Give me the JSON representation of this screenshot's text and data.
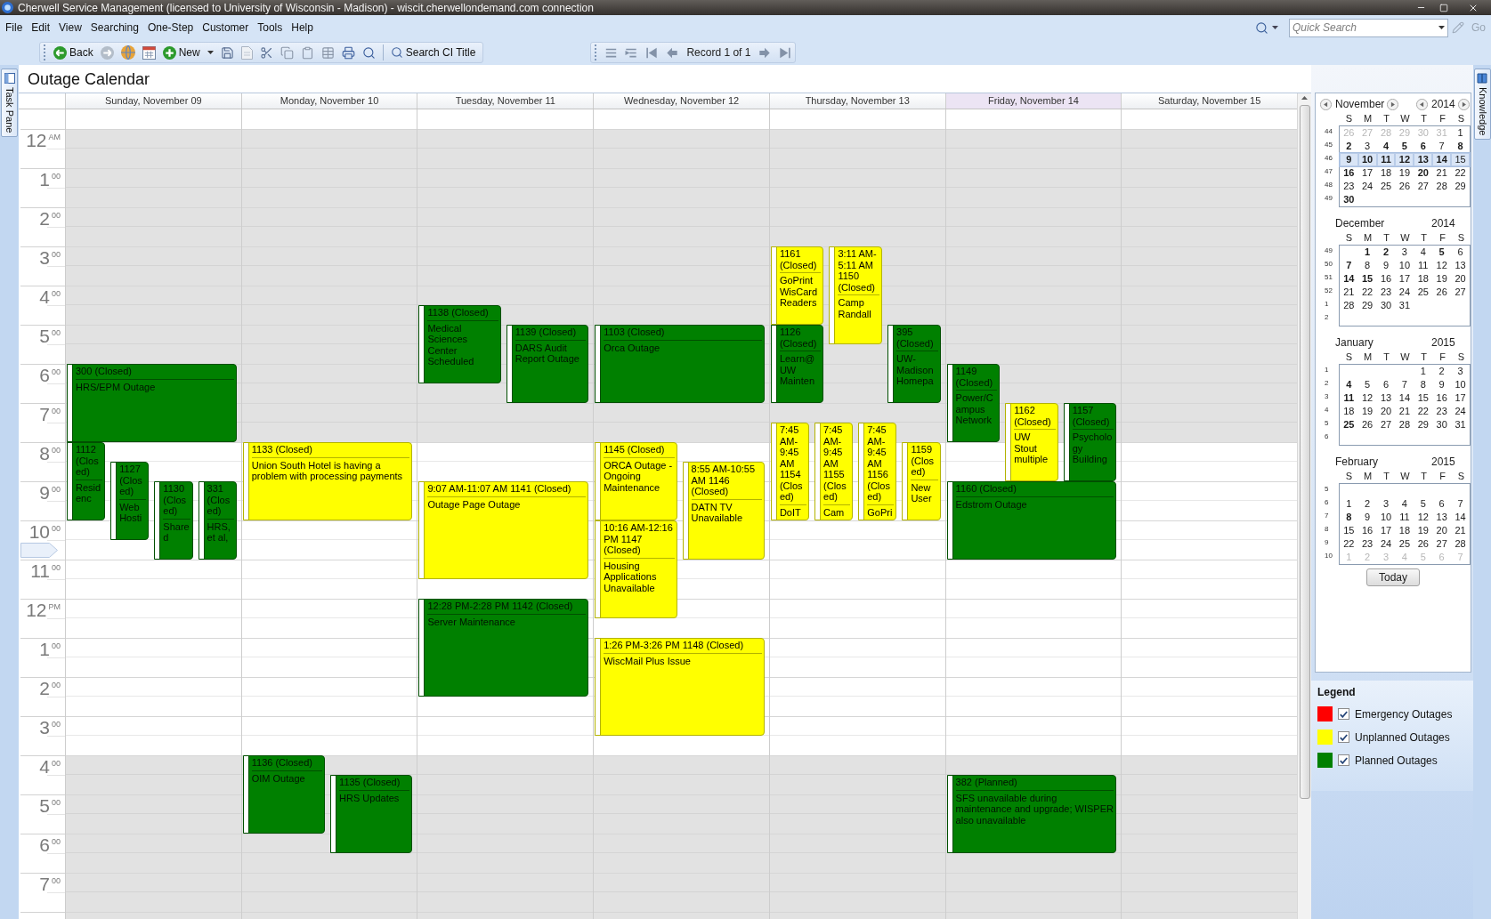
{
  "window": {
    "title": "Cherwell Service Management (licensed to University of Wisconsin - Madison) - wiscit.cherwellondemand.com connection"
  },
  "menu": [
    "File",
    "Edit",
    "View",
    "Searching",
    "One-Step",
    "Customer",
    "Tools",
    "Help"
  ],
  "quick_search": {
    "placeholder": "Quick Search"
  },
  "go": {
    "label": "Go",
    "disabled": true
  },
  "toolbar": {
    "back": "Back",
    "new": "New",
    "search_ci": "Search CI Title",
    "record": "Record 1 of 1"
  },
  "task_pane": "Task Pane",
  "knowledge": "Knowledge",
  "page_title": "Outage Calendar",
  "calendar": {
    "hours": [
      {
        "num": "12",
        "sup": "AM",
        "working": false,
        "current": false
      },
      {
        "num": "1",
        "sup": "00",
        "working": false,
        "current": false
      },
      {
        "num": "2",
        "sup": "00",
        "working": false,
        "current": false
      },
      {
        "num": "3",
        "sup": "00",
        "working": false,
        "current": false
      },
      {
        "num": "4",
        "sup": "00",
        "working": false,
        "current": false
      },
      {
        "num": "5",
        "sup": "00",
        "working": false,
        "current": false
      },
      {
        "num": "6",
        "sup": "00",
        "working": false,
        "current": false
      },
      {
        "num": "7",
        "sup": "00",
        "working": false,
        "current": false
      },
      {
        "num": "8",
        "sup": "00",
        "working": true,
        "current": false
      },
      {
        "num": "9",
        "sup": "00",
        "working": true,
        "current": false
      },
      {
        "num": "10",
        "sup": "00",
        "working": true,
        "current": true
      },
      {
        "num": "11",
        "sup": "00",
        "working": true,
        "current": false
      },
      {
        "num": "12",
        "sup": "PM",
        "working": true,
        "current": false
      },
      {
        "num": "1",
        "sup": "00",
        "working": true,
        "current": false
      },
      {
        "num": "2",
        "sup": "00",
        "working": true,
        "current": false
      },
      {
        "num": "3",
        "sup": "00",
        "working": true,
        "current": false
      },
      {
        "num": "4",
        "sup": "00",
        "working": false,
        "current": false
      },
      {
        "num": "5",
        "sup": "00",
        "working": false,
        "current": false
      },
      {
        "num": "6",
        "sup": "00",
        "working": false,
        "current": false
      },
      {
        "num": "7",
        "sup": "00",
        "working": false,
        "current": false
      }
    ],
    "days": [
      {
        "label": "Sunday, November 09",
        "today": false,
        "events": [
          {
            "title": "300 (Closed)",
            "text": "HRS/EPM Outage",
            "color": "#008000"
          },
          {
            "title": "1112 (Closed)",
            "text": "Residenc",
            "color": "#008000"
          },
          {
            "title": "1127 (Closed)",
            "text": "Web Hosti",
            "color": "#008000"
          },
          {
            "title": "1130 (Closed)",
            "text": "Shared",
            "color": "#008000"
          },
          {
            "title": "331 (Closed)",
            "text": "HRS, et al,",
            "color": "#008000"
          }
        ]
      },
      {
        "label": "Monday, November 10",
        "today": false,
        "events": [
          {
            "title": "1133 (Closed)",
            "text": "Union South Hotel is having a problem with processing payments",
            "color": "#ffff00"
          },
          {
            "title": "1136 (Closed)",
            "text": "OIM Outage",
            "color": "#008000"
          },
          {
            "title": "1135 (Closed)",
            "text": "HRS Updates",
            "color": "#008000"
          }
        ]
      },
      {
        "label": "Tuesday, November 11",
        "today": false,
        "events": [
          {
            "title": "1138 (Closed)",
            "text": "Medical Sciences Center Scheduled",
            "color": "#008000"
          },
          {
            "title": "1139 (Closed)",
            "text": "DARS Audit Report Outage",
            "color": "#008000"
          },
          {
            "title": "9:07 AM-11:07 AM 1141 (Closed)",
            "text": "Outage Page Outage",
            "color": "#ffff00"
          },
          {
            "title": "12:28 PM-2:28 PM 1142 (Closed)",
            "text": "Server Maintenance",
            "color": "#008000"
          }
        ]
      },
      {
        "label": "Wednesday, November 12",
        "today": false,
        "events": [
          {
            "title": "1103 (Closed)",
            "text": "Orca Outage",
            "color": "#008000"
          },
          {
            "title": "1145 (Closed)",
            "text": "ORCA Outage - Ongoing Maintenance",
            "color": "#ffff00"
          },
          {
            "title": "8:55 AM-10:55 AM 1146 (Closed)",
            "text": "DATN TV Unavailable",
            "color": "#ffff00"
          },
          {
            "title": "10:16 AM-12:16 PM 1147 (Closed)",
            "text": "Housing Applications Unavailable",
            "color": "#ffff00"
          },
          {
            "title": "1:26 PM-3:26 PM 1148 (Closed)",
            "text": "WiscMail Plus Issue",
            "color": "#ffff00"
          }
        ]
      },
      {
        "label": "Thursday, November 13",
        "today": false,
        "events": [
          {
            "title": "1161 (Closed)",
            "text": "GoPrint WisCard Readers",
            "color": "#ffff00"
          },
          {
            "title": "3:11 AM-5:11 AM 1150 (Closed)",
            "text": "Camp Randall",
            "color": "#ffff00"
          },
          {
            "title": "1126 (Closed)",
            "text": "Learn@UW Mainten",
            "color": "#008000"
          },
          {
            "title": "395 (Closed)",
            "text": "UW-Madison Homepa",
            "color": "#008000"
          },
          {
            "title": "7:45 AM-9:45 AM 1154 (Closed)",
            "text": "DoIT",
            "color": "#ffff00"
          },
          {
            "title": "7:45 AM-9:45 AM 1155 (Closed)",
            "text": "Cam",
            "color": "#ffff00"
          },
          {
            "title": "7:45 AM-9:45 AM 1156 (Closed)",
            "text": "GoPri",
            "color": "#ffff00"
          },
          {
            "title": "1159 (Closed)",
            "text": "New User",
            "color": "#ffff00"
          }
        ]
      },
      {
        "label": "Friday, November 14",
        "today": true,
        "events": [
          {
            "title": "1149 (Closed)",
            "text": "Power/Campus Network",
            "color": "#008000"
          },
          {
            "title": "1162 (Closed)",
            "text": "UW Stout multiple",
            "color": "#ffff00"
          },
          {
            "title": "1157 (Closed)",
            "text": "Psychology Building",
            "color": "#008000"
          },
          {
            "title": "1160 (Closed)",
            "text": "Edstrom Outage",
            "color": "#008000"
          },
          {
            "title": "382 (Planned)",
            "text": "SFS unavailable during maintenance and upgrade; WISPER also unavailable",
            "color": "#008000"
          }
        ]
      },
      {
        "label": "Saturday, November 15",
        "today": false
      }
    ]
  },
  "mini_calendar": {
    "today_button": "Today",
    "months": [
      {
        "month": "November",
        "year": "2014",
        "nav": true,
        "weekdays": [
          "S",
          "M",
          "T",
          "W",
          "T",
          "F",
          "S"
        ],
        "weeks": [
          {
            "week": "44",
            "selected": false,
            "days": [
              {
                "text": "26",
                "bold": false,
                "muted": true
              },
              {
                "text": "27",
                "bold": false,
                "muted": true
              },
              {
                "text": "28",
                "bold": false,
                "muted": true
              },
              {
                "text": "29",
                "bold": false,
                "muted": true
              },
              {
                "text": "30",
                "bold": false,
                "muted": true
              },
              {
                "text": "31",
                "bold": false,
                "muted": true
              },
              {
                "text": "1",
                "bold": false,
                "muted": false
              }
            ]
          },
          {
            "week": "45",
            "selected": false,
            "days": [
              {
                "text": "2",
                "bold": true,
                "muted": false
              },
              {
                "text": "3",
                "bold": false,
                "muted": false
              },
              {
                "text": "4",
                "bold": true,
                "muted": false
              },
              {
                "text": "5",
                "bold": true,
                "muted": false
              },
              {
                "text": "6",
                "bold": true,
                "muted": false
              },
              {
                "text": "7",
                "bold": false,
                "muted": false
              },
              {
                "text": "8",
                "bold": true,
                "muted": false
              }
            ]
          },
          {
            "week": "46",
            "selected": true,
            "days": [
              {
                "text": "9",
                "bold": true,
                "muted": false
              },
              {
                "text": "10",
                "bold": true,
                "muted": false
              },
              {
                "text": "11",
                "bold": true,
                "muted": false
              },
              {
                "text": "12",
                "bold": true,
                "muted": false
              },
              {
                "text": "13",
                "bold": true,
                "muted": false
              },
              {
                "text": "14",
                "bold": true,
                "muted": false
              },
              {
                "text": "15",
                "bold": false,
                "muted": false
              }
            ]
          },
          {
            "week": "47",
            "selected": false,
            "days": [
              {
                "text": "16",
                "bold": true,
                "muted": false
              },
              {
                "text": "17",
                "bold": false,
                "muted": false
              },
              {
                "text": "18",
                "bold": false,
                "muted": false
              },
              {
                "text": "19",
                "bold": false,
                "muted": false
              },
              {
                "text": "20",
                "bold": true,
                "muted": false
              },
              {
                "text": "21",
                "bold": false,
                "muted": false
              },
              {
                "text": "22",
                "bold": false,
                "muted": false
              }
            ]
          },
          {
            "week": "48",
            "selected": false,
            "days": [
              {
                "text": "23",
                "bold": false,
                "muted": false
              },
              {
                "text": "24",
                "bold": false,
                "muted": false
              },
              {
                "text": "25",
                "bold": false,
                "muted": false
              },
              {
                "text": "26",
                "bold": false,
                "muted": false
              },
              {
                "text": "27",
                "bold": false,
                "muted": false
              },
              {
                "text": "28",
                "bold": false,
                "muted": false
              },
              {
                "text": "29",
                "bold": false,
                "muted": false
              }
            ]
          },
          {
            "week": "49",
            "selected": false,
            "days": [
              {
                "text": "30",
                "bold": true,
                "muted": false
              }
            ]
          }
        ]
      },
      {
        "month": "December",
        "year": "2014",
        "nav": false,
        "weekdays": [
          "S",
          "M",
          "T",
          "W",
          "T",
          "F",
          "S"
        ],
        "weeks": [
          {
            "week": "49",
            "selected": false,
            "days": [
              {
                "text": "1",
                "bold": true,
                "muted": false
              },
              {
                "text": "2",
                "bold": true,
                "muted": false
              },
              {
                "text": "3",
                "bold": false,
                "muted": false
              },
              {
                "text": "4",
                "bold": false,
                "muted": false
              },
              {
                "text": "5",
                "bold": true,
                "muted": false
              },
              {
                "text": "6",
                "bold": false,
                "muted": false
              }
            ]
          },
          {
            "week": "50",
            "selected": false,
            "days": [
              {
                "text": "7",
                "bold": true,
                "muted": false
              },
              {
                "text": "8",
                "bold": false,
                "muted": false
              },
              {
                "text": "9",
                "bold": false,
                "muted": false
              },
              {
                "text": "10",
                "bold": false,
                "muted": false
              },
              {
                "text": "11",
                "bold": false,
                "muted": false
              },
              {
                "text": "12",
                "bold": false,
                "muted": false
              },
              {
                "text": "13",
                "bold": false,
                "muted": false
              }
            ]
          },
          {
            "week": "51",
            "selected": false,
            "days": [
              {
                "text": "14",
                "bold": true,
                "muted": false
              },
              {
                "text": "15",
                "bold": true,
                "muted": false
              },
              {
                "text": "16",
                "bold": false,
                "muted": false
              },
              {
                "text": "17",
                "bold": false,
                "muted": false
              },
              {
                "text": "18",
                "bold": false,
                "muted": false
              },
              {
                "text": "19",
                "bold": false,
                "muted": false
              },
              {
                "text": "20",
                "bold": false,
                "muted": false
              }
            ]
          },
          {
            "week": "52",
            "selected": false,
            "days": [
              {
                "text": "21",
                "bold": false,
                "muted": false
              },
              {
                "text": "22",
                "bold": false,
                "muted": false
              },
              {
                "text": "23",
                "bold": false,
                "muted": false
              },
              {
                "text": "24",
                "bold": false,
                "muted": false
              },
              {
                "text": "25",
                "bold": false,
                "muted": false
              },
              {
                "text": "26",
                "bold": false,
                "muted": false
              },
              {
                "text": "27",
                "bold": false,
                "muted": false
              }
            ]
          },
          {
            "week": "1",
            "selected": false,
            "days": [
              {
                "text": "28",
                "bold": false,
                "muted": false
              },
              {
                "text": "29",
                "bold": false,
                "muted": false
              },
              {
                "text": "30",
                "bold": false,
                "muted": false
              },
              {
                "text": "31",
                "bold": false,
                "muted": false
              }
            ]
          },
          {
            "week": "2",
            "selected": false
          }
        ]
      },
      {
        "month": "January",
        "year": "2015",
        "nav": false,
        "weekdays": [
          "S",
          "M",
          "T",
          "W",
          "T",
          "F",
          "S"
        ],
        "weeks": [
          {
            "week": "1",
            "selected": false,
            "days": [
              {
                "text": "1",
                "bold": false,
                "muted": false
              },
              {
                "text": "2",
                "bold": false,
                "muted": false
              },
              {
                "text": "3",
                "bold": false,
                "muted": false
              }
            ]
          },
          {
            "week": "2",
            "selected": false,
            "days": [
              {
                "text": "4",
                "bold": true,
                "muted": false
              },
              {
                "text": "5",
                "bold": false,
                "muted": false
              },
              {
                "text": "6",
                "bold": false,
                "muted": false
              },
              {
                "text": "7",
                "bold": false,
                "muted": false
              },
              {
                "text": "8",
                "bold": false,
                "muted": false
              },
              {
                "text": "9",
                "bold": false,
                "muted": false
              },
              {
                "text": "10",
                "bold": false,
                "muted": false
              }
            ]
          },
          {
            "week": "3",
            "selected": false,
            "days": [
              {
                "text": "11",
                "bold": true,
                "muted": false
              },
              {
                "text": "12",
                "bold": false,
                "muted": false
              },
              {
                "text": "13",
                "bold": false,
                "muted": false
              },
              {
                "text": "14",
                "bold": false,
                "muted": false
              },
              {
                "text": "15",
                "bold": false,
                "muted": false
              },
              {
                "text": "16",
                "bold": false,
                "muted": false
              },
              {
                "text": "17",
                "bold": false,
                "muted": false
              }
            ]
          },
          {
            "week": "4",
            "selected": false,
            "days": [
              {
                "text": "18",
                "bold": false,
                "muted": false
              },
              {
                "text": "19",
                "bold": false,
                "muted": false
              },
              {
                "text": "20",
                "bold": false,
                "muted": false
              },
              {
                "text": "21",
                "bold": false,
                "muted": false
              },
              {
                "text": "22",
                "bold": false,
                "muted": false
              },
              {
                "text": "23",
                "bold": false,
                "muted": false
              },
              {
                "text": "24",
                "bold": false,
                "muted": false
              }
            ]
          },
          {
            "week": "5",
            "selected": false,
            "days": [
              {
                "text": "25",
                "bold": true,
                "muted": false
              },
              {
                "text": "26",
                "bold": false,
                "muted": false
              },
              {
                "text": "27",
                "bold": false,
                "muted": false
              },
              {
                "text": "28",
                "bold": false,
                "muted": false
              },
              {
                "text": "29",
                "bold": false,
                "muted": false
              },
              {
                "text": "30",
                "bold": false,
                "muted": false
              },
              {
                "text": "31",
                "bold": false,
                "muted": false
              }
            ]
          },
          {
            "week": "6",
            "selected": false
          }
        ]
      },
      {
        "month": "February",
        "year": "2015",
        "nav": false,
        "weekdays": [
          "S",
          "M",
          "T",
          "W",
          "T",
          "F",
          "S"
        ],
        "weeks": [
          {
            "week": "5",
            "selected": false
          },
          {
            "week": "6",
            "selected": false,
            "days": [
              {
                "text": "1",
                "bold": false,
                "muted": false
              },
              {
                "text": "2",
                "bold": false,
                "muted": false
              },
              {
                "text": "3",
                "bold": false,
                "muted": false
              },
              {
                "text": "4",
                "bold": false,
                "muted": false
              },
              {
                "text": "5",
                "bold": false,
                "muted": false
              },
              {
                "text": "6",
                "bold": false,
                "muted": false
              },
              {
                "text": "7",
                "bold": false,
                "muted": false
              }
            ]
          },
          {
            "week": "7",
            "selected": false,
            "days": [
              {
                "text": "8",
                "bold": true,
                "muted": false
              },
              {
                "text": "9",
                "bold": false,
                "muted": false
              },
              {
                "text": "10",
                "bold": false,
                "muted": false
              },
              {
                "text": "11",
                "bold": false,
                "muted": false
              },
              {
                "text": "12",
                "bold": false,
                "muted": false
              },
              {
                "text": "13",
                "bold": false,
                "muted": false
              },
              {
                "text": "14",
                "bold": false,
                "muted": false
              }
            ]
          },
          {
            "week": "8",
            "selected": false,
            "days": [
              {
                "text": "15",
                "bold": false,
                "muted": false
              },
              {
                "text": "16",
                "bold": false,
                "muted": false
              },
              {
                "text": "17",
                "bold": false,
                "muted": false
              },
              {
                "text": "18",
                "bold": false,
                "muted": false
              },
              {
                "text": "19",
                "bold": false,
                "muted": false
              },
              {
                "text": "20",
                "bold": false,
                "muted": false
              },
              {
                "text": "21",
                "bold": false,
                "muted": false
              }
            ]
          },
          {
            "week": "9",
            "selected": false,
            "days": [
              {
                "text": "22",
                "bold": false,
                "muted": false
              },
              {
                "text": "23",
                "bold": false,
                "muted": false
              },
              {
                "text": "24",
                "bold": false,
                "muted": false
              },
              {
                "text": "25",
                "bold": false,
                "muted": false
              },
              {
                "text": "26",
                "bold": false,
                "muted": false
              },
              {
                "text": "27",
                "bold": false,
                "muted": false
              },
              {
                "text": "28",
                "bold": false,
                "muted": false
              }
            ]
          },
          {
            "week": "10",
            "selected": false,
            "days": [
              {
                "text": "1",
                "bold": false,
                "muted": true
              },
              {
                "text": "2",
                "bold": false,
                "muted": true
              },
              {
                "text": "3",
                "bold": false,
                "muted": true
              },
              {
                "text": "4",
                "bold": false,
                "muted": true
              },
              {
                "text": "5",
                "bold": false,
                "muted": true
              },
              {
                "text": "6",
                "bold": false,
                "muted": true
              },
              {
                "text": "7",
                "bold": false,
                "muted": true
              }
            ]
          }
        ]
      }
    ]
  },
  "legend": {
    "title": "Legend",
    "items": [
      {
        "label": "Emergency Outages",
        "color": "#ff0000",
        "checked": true
      },
      {
        "label": "Unplanned Outages",
        "color": "#ffff00",
        "checked": true
      },
      {
        "label": "Planned Outages",
        "color": "#008000",
        "checked": true
      }
    ]
  }
}
